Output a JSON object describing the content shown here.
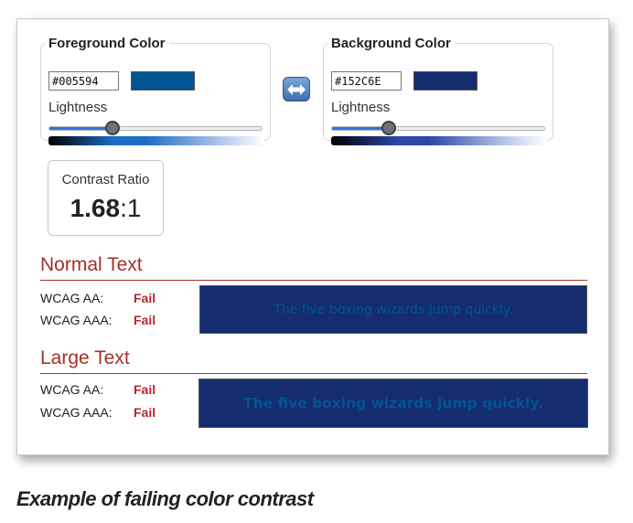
{
  "foreground": {
    "title": "Foreground Color",
    "hex": "#005594",
    "swatch_color": "#005594",
    "lightness_label": "Lightness",
    "lightness_level": 0.3
  },
  "background": {
    "title": "Background Color",
    "hex": "#152C6E",
    "swatch_color": "#152C6E",
    "lightness_label": "Lightness",
    "lightness_level": 0.27
  },
  "swap_icon": "swap-arrows-icon",
  "contrast": {
    "label": "Contrast Ratio",
    "value": "1.68",
    "suffix": ":1"
  },
  "normal_text": {
    "heading": "Normal Text",
    "aa_label": "WCAG AA:",
    "aa_result": "Fail",
    "aaa_label": "WCAG AAA:",
    "aaa_result": "Fail",
    "sample": "The five boxing wizards jump quickly."
  },
  "large_text": {
    "heading": "Large Text",
    "aa_label": "WCAG AA:",
    "aa_result": "Fail",
    "aaa_label": "WCAG AAA:",
    "aaa_result": "Fail",
    "sample": "The five boxing wizards jump quickly."
  },
  "colors": {
    "fail": "#b3282d",
    "heading": "#a3302a",
    "slider_fill": "#2f73dc"
  },
  "caption": "Example of failing color contrast"
}
